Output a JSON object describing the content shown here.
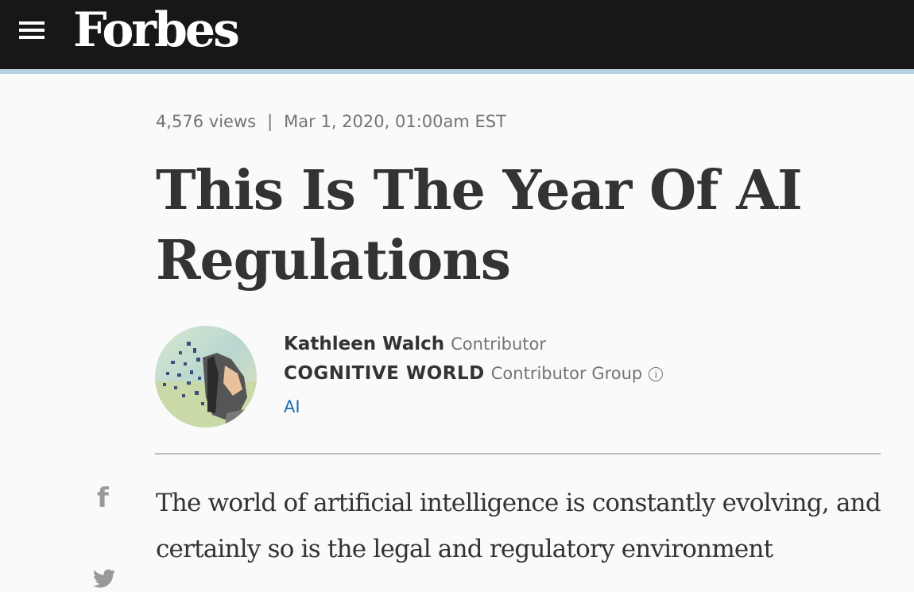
{
  "header": {
    "logo": "Forbes",
    "menu_icon": "hamburger-menu-icon",
    "background": "#181716",
    "accent": "#b7d1e2"
  },
  "article": {
    "views": "4,576 views",
    "separator": "|",
    "date": "Mar 1, 2020, 01:00am EST",
    "title": "This Is The Year Of AI Regulations",
    "author": {
      "name": "Kathleen Walch",
      "role": "Contributor",
      "group": "COGNITIVE WORLD",
      "group_role": "Contributor Group",
      "info_icon": "info-icon",
      "topic": "AI"
    },
    "body_text": "The world of artificial intelligence is constantly evolving, and certainly so is the legal and regulatory environment"
  },
  "share": {
    "facebook_icon": "f",
    "twitter_icon": "twitter-icon"
  },
  "colors": {
    "text": "#333333",
    "muted": "#747474",
    "link": "#1a6fb5"
  }
}
